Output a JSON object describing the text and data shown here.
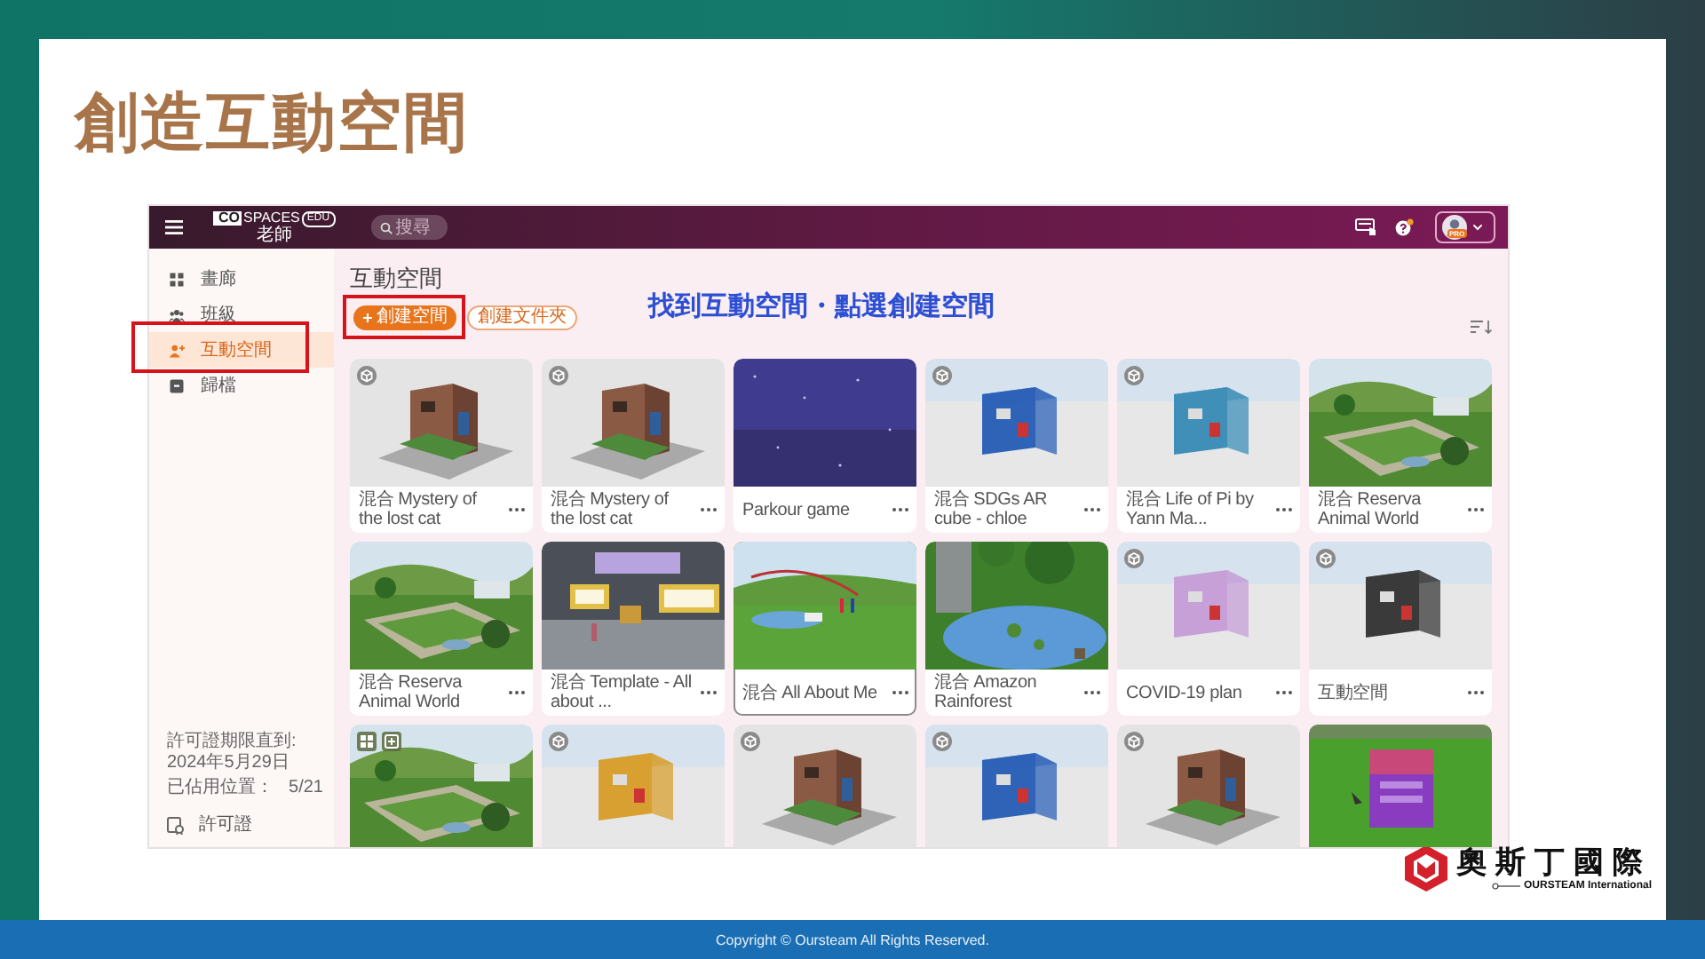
{
  "slide": {
    "title": "創造互動空間",
    "annotation": "找到互動空間・點選創建空間",
    "brand_name": "奧斯丁國際",
    "brand_tagline": "OURSTEAM International",
    "footer": "Copyright © Oursteam All Rights Reserved."
  },
  "app": {
    "logo": {
      "mark": "CO",
      "name": "SPACES",
      "tag": "EDU",
      "role": "老師"
    },
    "search": {
      "placeholder": "搜尋"
    },
    "account_badge": "PRO",
    "sidebar": {
      "items": [
        {
          "label": "畫廊",
          "selected": false,
          "annotated": false
        },
        {
          "label": "班級",
          "selected": false,
          "annotated": false
        },
        {
          "label": "互動空間",
          "selected": true,
          "annotated": true
        },
        {
          "label": "歸檔",
          "selected": false,
          "annotated": false
        }
      ],
      "license_until": "許可證期限直到:  2024年5月29日",
      "seats_label": "已佔用位置：",
      "seats_value": "5/21",
      "license_link": "許可證"
    },
    "page_title": "互動空間",
    "buttons": [
      {
        "kind": "primary",
        "label": "創建空間",
        "annotated": true
      },
      {
        "kind": "outline",
        "label": "創建文件夾",
        "annotated": false
      }
    ],
    "cards": [
      {
        "title": "混合 Mystery of the lost cat",
        "kind": "cube",
        "selected": false
      },
      {
        "title": "混合 Mystery of the lost cat",
        "kind": "cube",
        "selected": false
      },
      {
        "title": "Parkour game",
        "kind": "plain",
        "selected": false
      },
      {
        "title": "混合 SDGs AR cube - chloe",
        "kind": "cube",
        "selected": false
      },
      {
        "title": "混合 Life of Pi by Yann Ma...",
        "kind": "cube",
        "selected": false
      },
      {
        "title": "混合 Reserva Animal World",
        "kind": "plain",
        "selected": false
      },
      {
        "title": "混合 Reserva Animal World",
        "kind": "plain",
        "selected": false
      },
      {
        "title": "混合 Template - All about ...",
        "kind": "plain",
        "selected": false
      },
      {
        "title": "混合 All About Me",
        "kind": "plain",
        "selected": true
      },
      {
        "title": "混合 Amazon Rainforest",
        "kind": "plain",
        "selected": false
      },
      {
        "title": "COVID-19 plan",
        "kind": "cube",
        "selected": false
      },
      {
        "title": "互動空間",
        "kind": "cube",
        "selected": false
      },
      {
        "kind": "grid",
        "selected": false
      },
      {
        "kind": "cube",
        "selected": false
      },
      {
        "kind": "cube",
        "selected": false
      },
      {
        "kind": "cube",
        "selected": false
      },
      {
        "kind": "cube",
        "selected": false
      },
      {
        "kind": "plain",
        "selected": false
      }
    ]
  }
}
